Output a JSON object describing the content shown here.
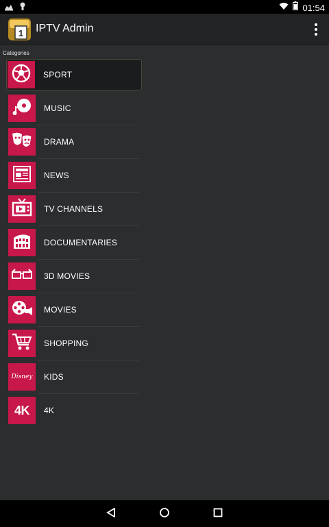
{
  "status_bar": {
    "time": "01:54"
  },
  "action_bar": {
    "title": "IPTV Admin",
    "app_icon_glyph": "1"
  },
  "section_label": "Categories",
  "categories": [
    {
      "label": "SPORT",
      "icon": "soccer-ball-icon",
      "selected": true
    },
    {
      "label": "MUSIC",
      "icon": "music-disc-icon"
    },
    {
      "label": "DRAMA",
      "icon": "theater-masks-icon"
    },
    {
      "label": "NEWS",
      "icon": "newspaper-icon"
    },
    {
      "label": "TV CHANNELS",
      "icon": "tv-icon"
    },
    {
      "label": "DOCUMENTARIES",
      "icon": "colosseum-icon"
    },
    {
      "label": "3D MOVIES",
      "icon": "3d-glasses-icon"
    },
    {
      "label": "MOVIES",
      "icon": "film-projector-icon"
    },
    {
      "label": "SHOPPING",
      "icon": "shopping-cart-icon"
    },
    {
      "label": "KIDS",
      "icon": "disney-logo-icon",
      "icon_text": "Disney"
    },
    {
      "label": "4K",
      "icon": "4k-icon",
      "icon_text": "4K"
    }
  ],
  "colors": {
    "tile": "#c8174a",
    "background": "#2b2d2f",
    "action_bar": "#212325"
  }
}
